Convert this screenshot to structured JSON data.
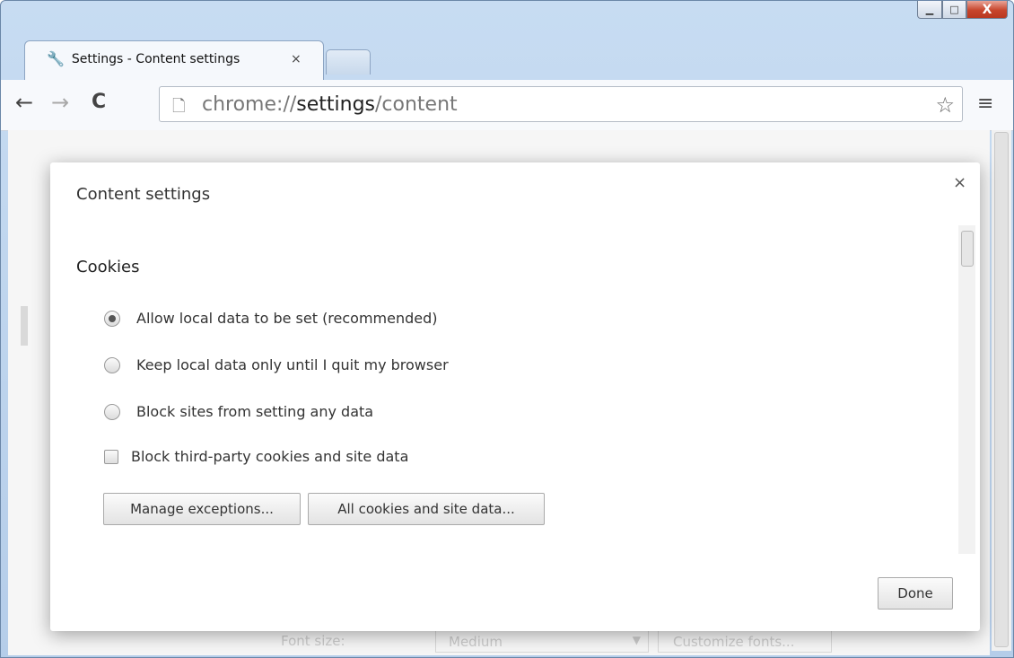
{
  "window": {
    "controls": {
      "minimize": "▁",
      "maximize": "□",
      "close": "X"
    }
  },
  "tabs": [
    {
      "title": "Settings - Content settings",
      "icon": "wrench-icon",
      "close": "×"
    }
  ],
  "toolbar": {
    "back": "←",
    "forward": "→",
    "reload": "C",
    "url_prefix": "chrome://",
    "url_host": "settings",
    "url_path": "/content",
    "star": "☆",
    "menu": "≡"
  },
  "background_page": {
    "font_size_label": "Font size:",
    "font_size_value": "Medium",
    "customize_fonts": "Customize fonts..."
  },
  "dialog": {
    "title": "Content settings",
    "close": "×",
    "section": "Cookies",
    "options": [
      {
        "label": "Allow local data to be set (recommended)",
        "checked": true
      },
      {
        "label": "Keep local data only until I quit my browser",
        "checked": false
      },
      {
        "label": "Block sites from setting any data",
        "checked": false
      }
    ],
    "checkbox_label": "Block third-party cookies and site data",
    "checkbox_checked": false,
    "manage_exceptions": "Manage exceptions...",
    "all_cookies": "All cookies and site data...",
    "done": "Done"
  }
}
